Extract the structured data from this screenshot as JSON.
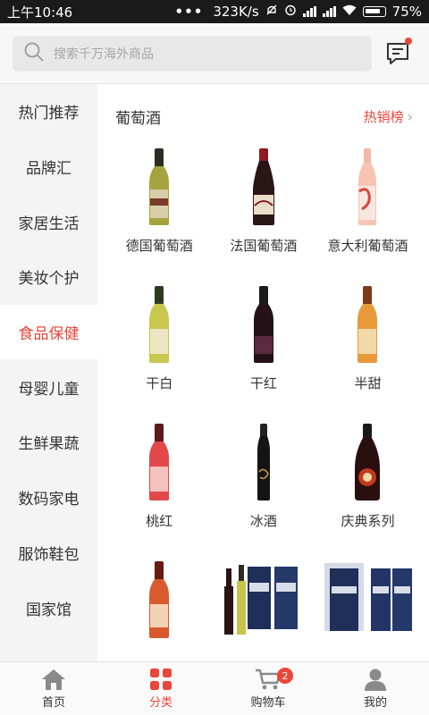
{
  "status_bar": {
    "time": "上午10:46",
    "dots": "•••",
    "speed": "323K/s",
    "battery": "75%"
  },
  "search": {
    "placeholder": "搜索千万海外商品"
  },
  "sidebar": {
    "items": [
      {
        "label": "热门推荐"
      },
      {
        "label": "品牌汇"
      },
      {
        "label": "家居生活"
      },
      {
        "label": "美妆个护"
      },
      {
        "label": "食品保健",
        "active": true
      },
      {
        "label": "母婴儿童"
      },
      {
        "label": "生鲜果蔬"
      },
      {
        "label": "数码家电"
      },
      {
        "label": "服饰鞋包"
      },
      {
        "label": "国家馆"
      }
    ]
  },
  "section": {
    "title": "葡萄酒",
    "more_label": "热销榜"
  },
  "products": [
    {
      "label": "德国葡萄酒",
      "icon": "white-wine-bottle-icon"
    },
    {
      "label": "法国葡萄酒",
      "icon": "red-wine-bottle-icon"
    },
    {
      "label": "意大利葡萄酒",
      "icon": "rose-wine-bottle-icon"
    },
    {
      "label": "干白",
      "icon": "dry-white-bottle-icon"
    },
    {
      "label": "干红",
      "icon": "dry-red-bottle-icon"
    },
    {
      "label": "半甜",
      "icon": "semi-sweet-bottle-icon"
    },
    {
      "label": "桃红",
      "icon": "rose-bottle-icon"
    },
    {
      "label": "冰酒",
      "icon": "ice-wine-bottle-icon"
    },
    {
      "label": "庆典系列",
      "icon": "celebration-bottle-icon"
    },
    {
      "label": "",
      "icon": "wine-bottle-icon"
    },
    {
      "label": "",
      "icon": "gift-box-set-icon"
    },
    {
      "label": "",
      "icon": "gift-box-set-icon"
    }
  ],
  "tabbar": {
    "tabs": [
      {
        "label": "首页",
        "icon": "home-icon"
      },
      {
        "label": "分类",
        "icon": "category-grid-icon",
        "active": true
      },
      {
        "label": "购物车",
        "icon": "cart-icon",
        "badge": "2"
      },
      {
        "label": "我的",
        "icon": "profile-icon"
      }
    ]
  },
  "colors": {
    "accent": "#e8473a",
    "sidebar_bg": "#f4f4f4",
    "status_bg": "#1a1a1a"
  }
}
